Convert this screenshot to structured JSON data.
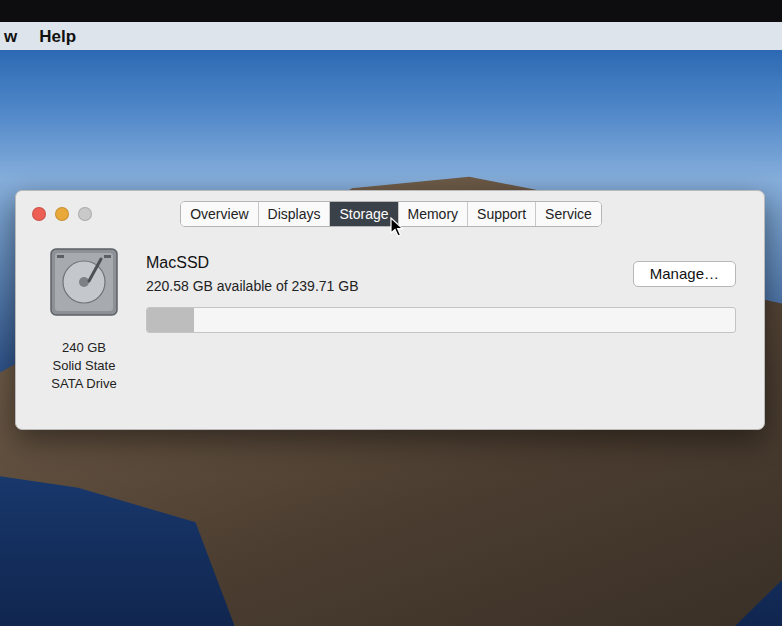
{
  "menu_bar": {
    "items": [
      "w",
      "Help"
    ]
  },
  "window_controls": [
    {
      "color": "#ed5e55"
    },
    {
      "color": "#e9a83a"
    },
    {
      "color": "#c9c9c9"
    }
  ],
  "tabs": [
    {
      "label": "Overview",
      "selected": false
    },
    {
      "label": "Displays",
      "selected": false
    },
    {
      "label": "Storage",
      "selected": true
    },
    {
      "label": "Memory",
      "selected": false
    },
    {
      "label": "Support",
      "selected": false
    },
    {
      "label": "Service",
      "selected": false
    }
  ],
  "drive": {
    "size": "240 GB",
    "type": "Solid State",
    "interface": "SATA Drive"
  },
  "volume": {
    "name": "MacSSD",
    "summary": "220.58 GB available of 239.71 GB",
    "level": 0.08
  },
  "buttons": [
    "Manage…"
  ]
}
